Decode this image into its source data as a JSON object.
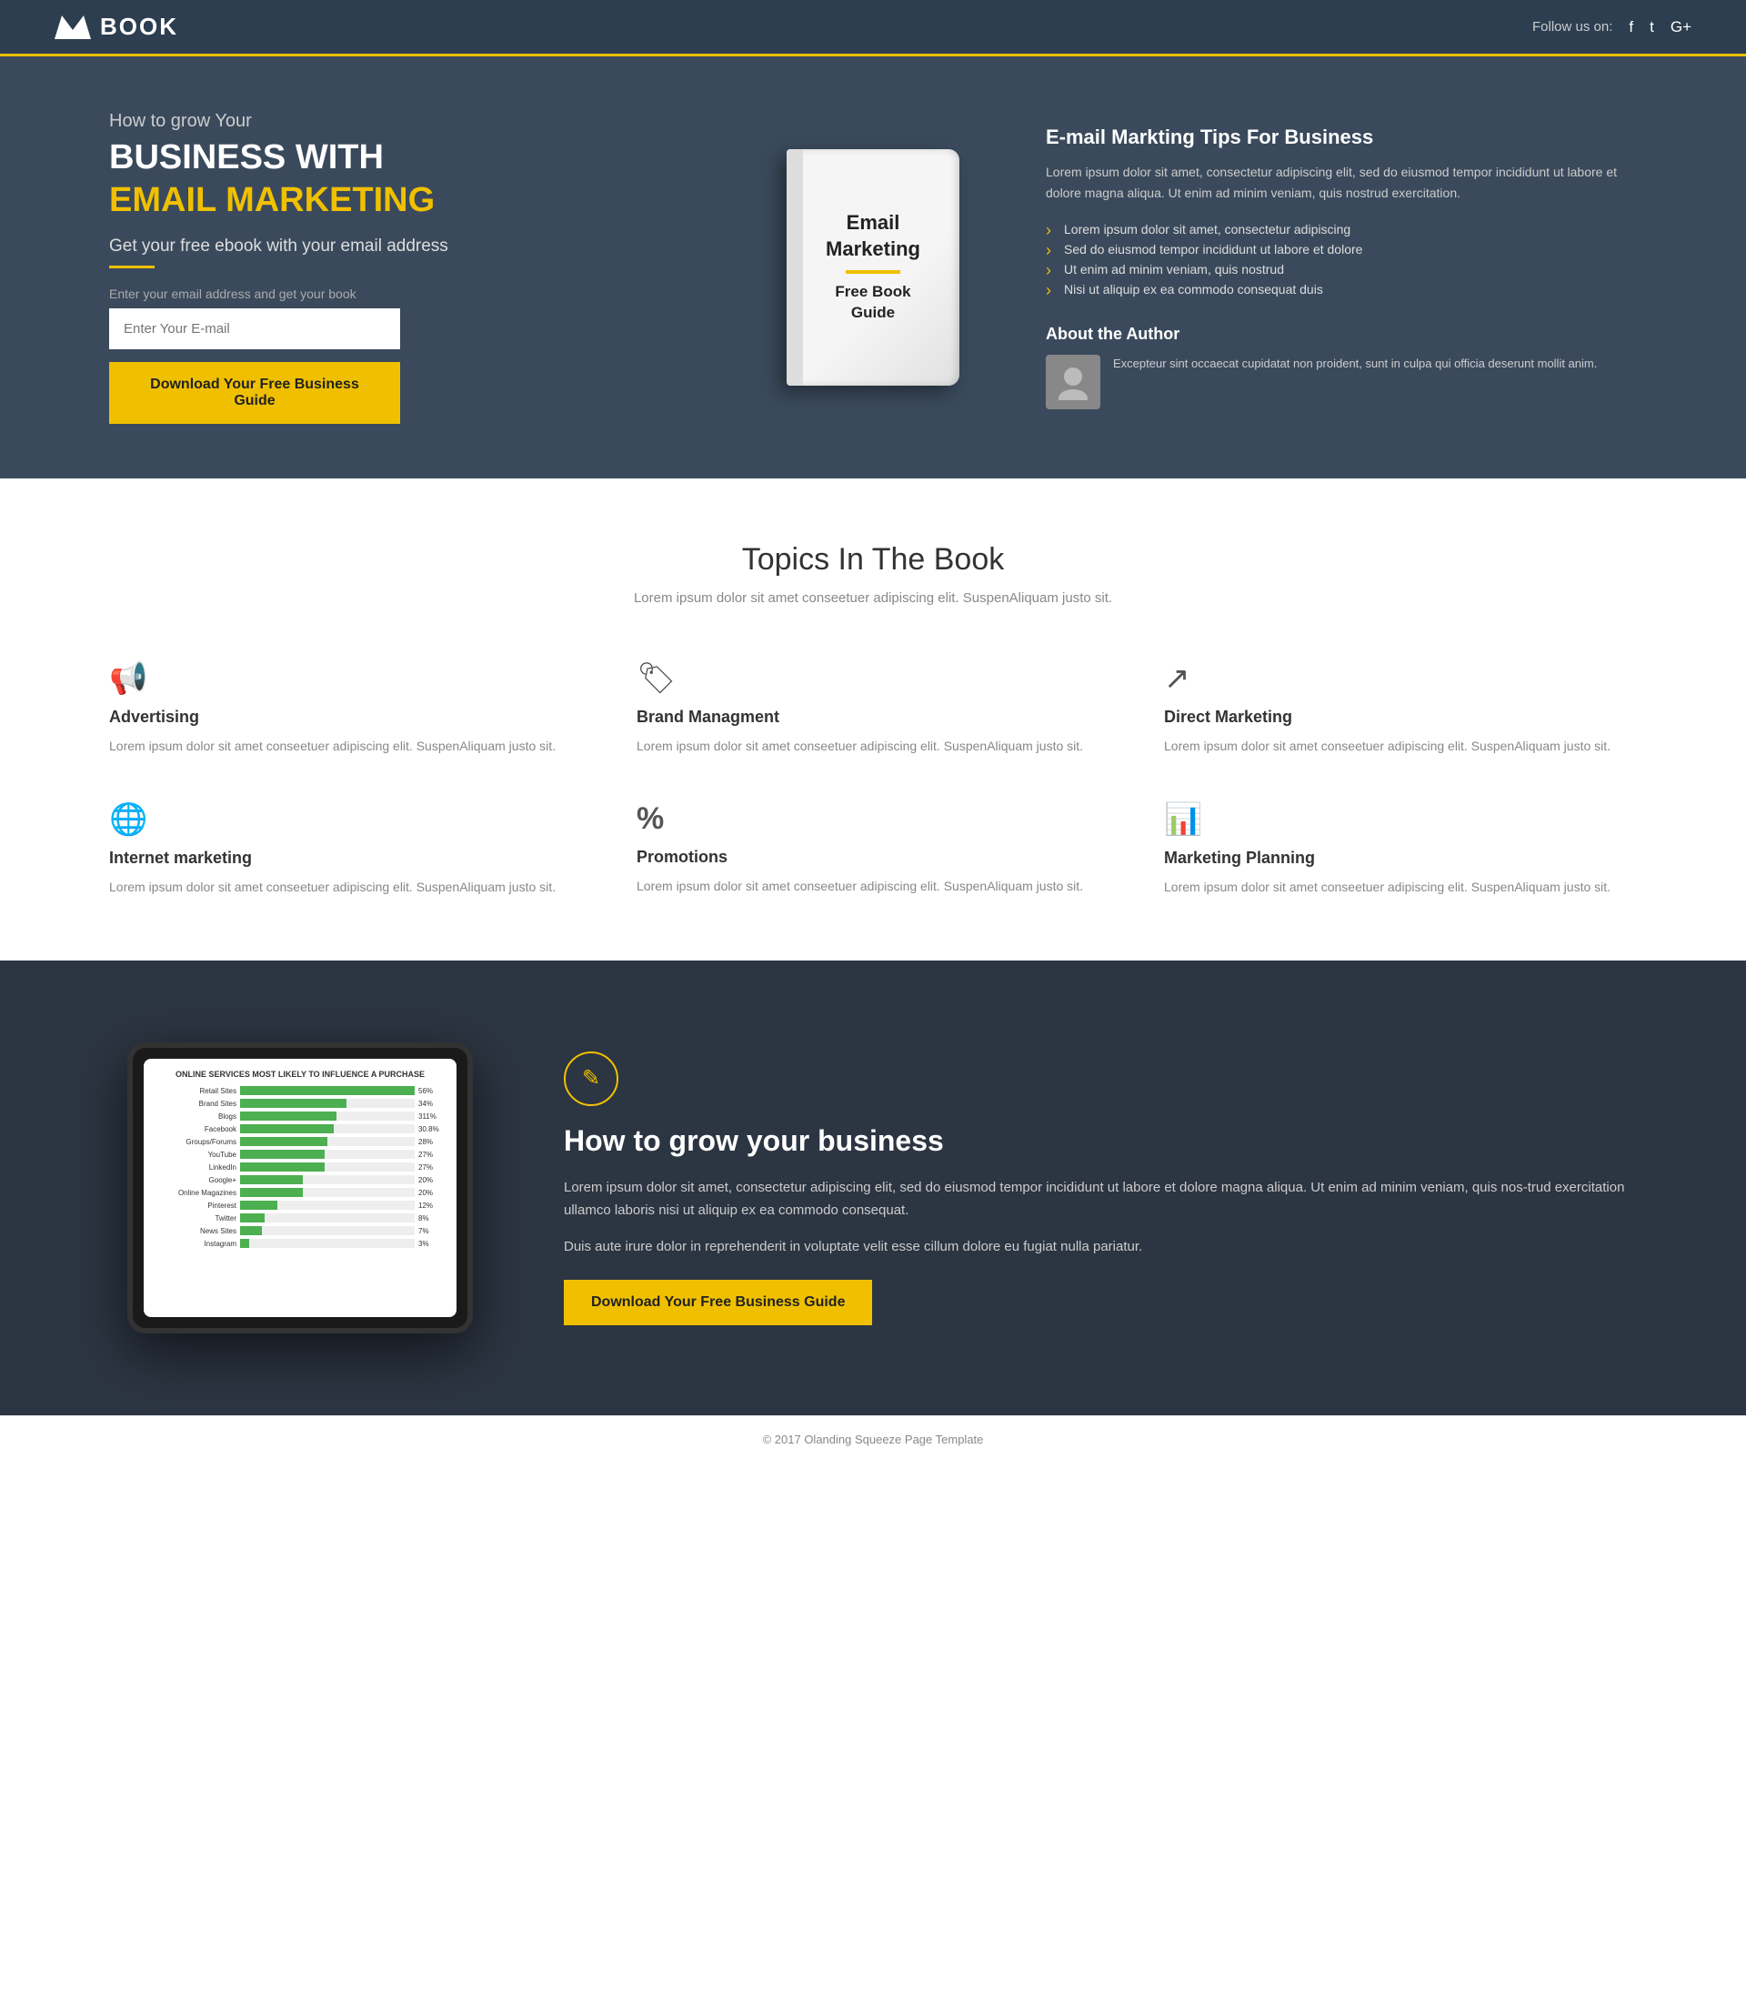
{
  "header": {
    "logo_text": "BOOK",
    "social_label": "Follow us on:",
    "social_icons": [
      "f",
      "t",
      "G+"
    ]
  },
  "hero": {
    "subtitle": "How to grow Your",
    "title_bold": "BUSINESS WITH",
    "title_yellow": "EMAIL MARKETING",
    "desc": "Get your free ebook with your email address",
    "input_label": "Enter your email address and get your book",
    "input_placeholder": "Enter Your E-mail",
    "btn_label": "Download Your Free Business Guide"
  },
  "book": {
    "line1": "Email",
    "line2": "Marketing",
    "line3": "Free Book",
    "line4": "Guide"
  },
  "tips": {
    "title": "E-mail Markting Tips For Business",
    "text": "Lorem ipsum dolor sit amet, consectetur adipiscing elit, sed do eiusmod tempor incididunt ut labore et dolore magna aliqua. Ut enim ad minim veniam, quis nostrud exercitation.",
    "list": [
      "Lorem ipsum dolor sit amet, consectetur adipiscing",
      "Sed do eiusmod tempor incididunt ut labore et dolore",
      "Ut enim ad minim veniam, quis nostrud",
      "Nisi ut aliquip ex ea commodo consequat duis"
    ],
    "author_title": "About the Author",
    "author_text": "Excepteur sint occaecat cupidatat non proident, sunt in culpa qui officia deserunt mollit anim."
  },
  "topics": {
    "title": "Topics In The Book",
    "desc": "Lorem ipsum dolor sit amet conseetuer adipiscing elit. SuspenAliquam justo sit.",
    "items": [
      {
        "icon": "📢",
        "name": "Advertising",
        "text": "Lorem ipsum dolor sit amet conseetuer adipiscing elit. SuspenAliquam justo sit."
      },
      {
        "icon": "🏷",
        "name": "Brand Managment",
        "text": "Lorem ipsum dolor sit amet conseetuer adipiscing elit. SuspenAliquam justo sit."
      },
      {
        "icon": "↗",
        "name": "Direct Marketing",
        "text": "Lorem ipsum dolor sit amet conseetuer adipiscing elit. SuspenAliquam justo sit."
      },
      {
        "icon": "🌐",
        "name": "Internet marketing",
        "text": "Lorem ipsum dolor sit amet conseetuer adipiscing elit. SuspenAliquam justo sit."
      },
      {
        "icon": "%",
        "name": "Promotions",
        "text": "Lorem ipsum dolor sit amet conseetuer adipiscing elit. SuspenAliquam justo sit."
      },
      {
        "icon": "📊",
        "name": "Marketing Planning",
        "text": "Lorem ipsum dolor sit amet conseetuer adipiscing elit. SuspenAliquam justo sit."
      }
    ]
  },
  "chart": {
    "title": "ONLINE SERVICES MOST LIKELY TO INFLUENCE A PURCHASE",
    "bars": [
      {
        "label": "Retail Sites",
        "pct": 56,
        "display": "56%"
      },
      {
        "label": "Brand Sites",
        "pct": 34,
        "display": "34%"
      },
      {
        "label": "Blogs",
        "pct": 31,
        "display": "311%"
      },
      {
        "label": "Facebook",
        "pct": 30,
        "display": "30.8%"
      },
      {
        "label": "Groups/Forums",
        "pct": 28,
        "display": "28%"
      },
      {
        "label": "YouTube",
        "pct": 27,
        "display": "27%"
      },
      {
        "label": "LinkedIn",
        "pct": 27,
        "display": "27%"
      },
      {
        "label": "Google+",
        "pct": 20,
        "display": "20%"
      },
      {
        "label": "Online Magazines",
        "pct": 20,
        "display": "20%"
      },
      {
        "label": "Pinterest",
        "pct": 12,
        "display": "12%"
      },
      {
        "label": "Twitter",
        "pct": 8,
        "display": "8%"
      },
      {
        "label": "News Sites",
        "pct": 7,
        "display": "7%"
      },
      {
        "label": "Instagram",
        "pct": 3,
        "display": "3%"
      }
    ]
  },
  "grow": {
    "title": "How to grow your business",
    "text1": "Lorem ipsum dolor sit amet, consectetur adipiscing elit, sed do eiusmod tempor incididunt ut labore et dolore magna aliqua. Ut enim ad minim veniam, quis nos-trud exercitation ullamco laboris nisi ut aliquip ex ea commodo consequat.",
    "text2": "Duis aute irure dolor in reprehenderit in voluptate velit esse cillum dolore eu fugiat nulla pariatur.",
    "btn_label": "Download Your Free Business Guide"
  },
  "footer": {
    "text": "© 2017 Olanding Squeeze Page Template"
  }
}
